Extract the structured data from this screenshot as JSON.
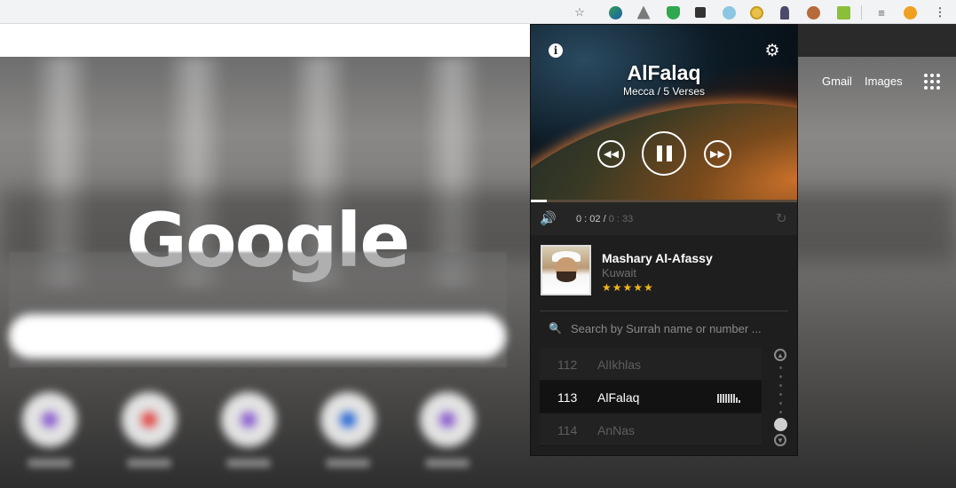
{
  "browser": {
    "extension_icons": [
      "bookmark-star-icon",
      "extension-globe-icon",
      "google-drive-icon",
      "shield-check-icon",
      "cube-icon",
      "globe-ball-icon",
      "quran-player-icon",
      "rocket-icon",
      "paint-icon",
      "download-arrow-icon",
      "media-queue-icon",
      "fire-icon",
      "more-vert-icon"
    ]
  },
  "ntp": {
    "logo_text": "Google",
    "gmail": "Gmail",
    "images": "Images"
  },
  "player": {
    "surah_name": "AlFalaq",
    "surah_meta": "Mecca / 5 Verses",
    "time_elapsed": "0 : 02 /",
    "time_total": "0 : 33",
    "progress_fraction": 0.06,
    "reciter": {
      "name": "Mashary Al-Afassy",
      "country": "Kuwait",
      "stars": "★★★★★",
      "rating": 5
    },
    "search": {
      "placeholder": "Search by Surrah name or number ..."
    },
    "list": [
      {
        "number": "112",
        "name": "AlIkhlas"
      },
      {
        "number": "113",
        "name": "AlFalaq"
      },
      {
        "number": "114",
        "name": "AnNas"
      }
    ],
    "active_index": 1,
    "icons": {
      "info": "i",
      "settings": "⚙",
      "rewind": "◀◀",
      "forward": "▶▶",
      "volume": "🔊",
      "repeat": "↻",
      "search": "🔍",
      "scroll_up": "▲",
      "scroll_down": "▼"
    }
  }
}
